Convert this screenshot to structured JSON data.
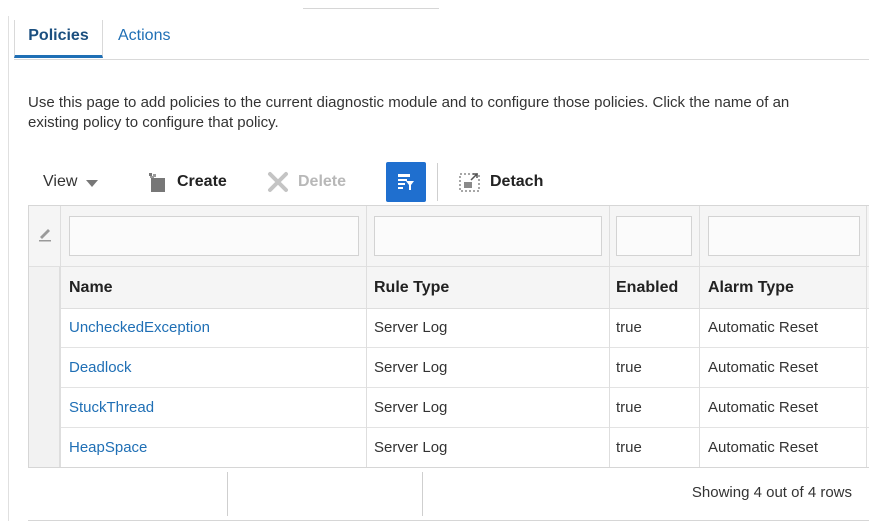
{
  "tabs": [
    {
      "label": "Policies",
      "selected": true
    },
    {
      "label": "Actions",
      "selected": false
    }
  ],
  "description": "Use this page to add policies to the current diagnostic module and to configure those policies. Click the name of an existing policy to configure that policy.",
  "toolbar": {
    "view_label": "View",
    "create_label": "Create",
    "delete_label": "Delete",
    "delete_enabled": false,
    "filter_icon": "filter-icon",
    "detach_label": "Detach"
  },
  "table": {
    "filter_values": [
      "",
      "",
      "",
      ""
    ],
    "columns": [
      "Name",
      "Rule Type",
      "Enabled",
      "Alarm Type"
    ],
    "rows": [
      {
        "name": "UncheckedException",
        "rule_type": "Server Log",
        "enabled": "true",
        "alarm_type": "Automatic Reset"
      },
      {
        "name": "Deadlock",
        "rule_type": "Server Log",
        "enabled": "true",
        "alarm_type": "Automatic Reset"
      },
      {
        "name": "StuckThread",
        "rule_type": "Server Log",
        "enabled": "true",
        "alarm_type": "Automatic Reset"
      },
      {
        "name": "HeapSpace",
        "rule_type": "Server Log",
        "enabled": "true",
        "alarm_type": "Automatic Reset"
      }
    ]
  },
  "footer": {
    "status": "Showing 4 out of 4 rows"
  },
  "colors": {
    "link": "#1f6fb5",
    "tab_accent": "#1f6fb5",
    "filter_button": "#1f6fcf"
  }
}
